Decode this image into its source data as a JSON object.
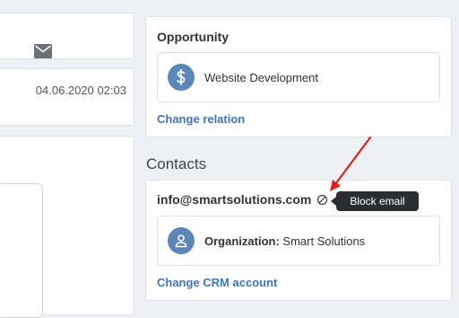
{
  "left_panel": {
    "date": "04.06.2020 02:03",
    "mail_icon": "mail-icon"
  },
  "opportunity": {
    "title": "Opportunity",
    "item_label": "Website Development",
    "item_icon": "dollar-icon",
    "change_link": "Change relation"
  },
  "contacts": {
    "heading": "Contacts",
    "email": "info@smartsolutions.com",
    "block_icon": "block-icon",
    "tooltip": "Block email",
    "org_label": "Organization:",
    "org_value": "Smart Solutions",
    "org_icon": "person-icon",
    "change_link": "Change CRM account"
  },
  "colors": {
    "accent": "#3f76b5",
    "icon_circle": "#5b86b8",
    "tooltip_bg": "#2b2d31",
    "annotation_arrow": "#e02020"
  }
}
